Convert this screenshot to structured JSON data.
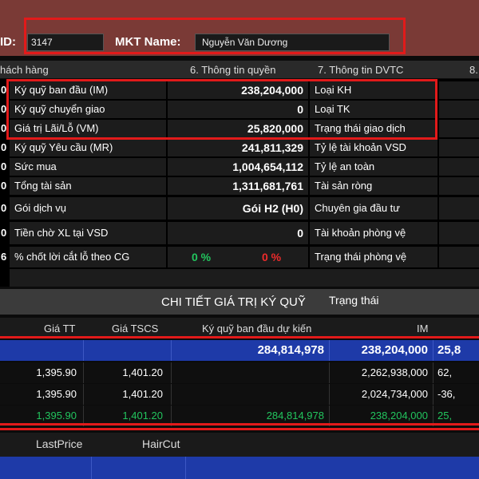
{
  "header": {
    "id_label": "ID:",
    "id_value": "3147",
    "mkt_label": "MKT Name:",
    "mkt_value": "Nguyễn Văn Dương"
  },
  "tabs": [
    "hách hàng",
    "6. Thông tin quyền",
    "7. Thông tin DVTC",
    "8."
  ],
  "left_edge": [
    "0",
    "0",
    "0",
    "0",
    "0",
    "0",
    "0",
    "0",
    "6"
  ],
  "rows": [
    {
      "label": "Ký quỹ ban đầu (IM)",
      "value": "238,204,000",
      "right": "Loại KH"
    },
    {
      "label": "Ký quỹ chuyển giao",
      "value": "0",
      "right": "Loại TK"
    },
    {
      "label": "Giá trị Lãi/Lỗ (VM)",
      "value": "25,820,000",
      "right": "Trạng thái giao dịch"
    },
    {
      "label": "Ký quỹ Yêu cầu (MR)",
      "value": "241,811,329",
      "right": "Tỷ lệ tài khoản VSD"
    },
    {
      "label": "Sức mua",
      "value": "1,004,654,112",
      "right": "Tỷ lệ an toàn"
    },
    {
      "label": "Tổng tài sản",
      "value": "1,311,681,761",
      "right": "Tài sản ròng"
    },
    {
      "label": "Gói dịch vụ",
      "value": "Gói H2 (H0)",
      "right": "Chuyên gia đầu tư"
    },
    {
      "label": "Tiền chờ XL tại VSD",
      "value": "0",
      "right": "Tài khoản phòng vệ"
    },
    {
      "label": "% chốt lời cắt lỗ theo CG",
      "value_green": "0 %",
      "value_red": "0 %",
      "right": "Trạng thái phòng vệ"
    }
  ],
  "section": {
    "title": "CHI TIẾT GIÁ TRỊ KÝ QUỸ",
    "status": "Trạng thái"
  },
  "table": {
    "headers": [
      "Giá TT",
      "Giá TSCS",
      "Ký quỹ ban đầu dự kiến",
      "IM"
    ],
    "summary": {
      "expected": "284,814,978",
      "im": "238,204,000",
      "extra": "25,8"
    },
    "rows": [
      {
        "price": "1,395.90",
        "tscs": "1,401.20",
        "expected": "",
        "im": "2,262,938,000",
        "extra": "62,"
      },
      {
        "price": "1,395.90",
        "tscs": "1,401.20",
        "expected": "",
        "im": "2,024,734,000",
        "extra": "-36,"
      },
      {
        "price": "1,395.90",
        "tscs": "1,401.20",
        "expected": "284,814,978",
        "im": "238,204,000",
        "extra": "25,"
      }
    ]
  },
  "bottom": {
    "headers": [
      "LastPrice",
      "HairCut"
    ]
  },
  "colors": {
    "bar": "#7a3a36",
    "highlight": "#1e3aa8",
    "green": "#22c55e",
    "red": "#ef2b2b",
    "annotation": "#e21a1a"
  }
}
